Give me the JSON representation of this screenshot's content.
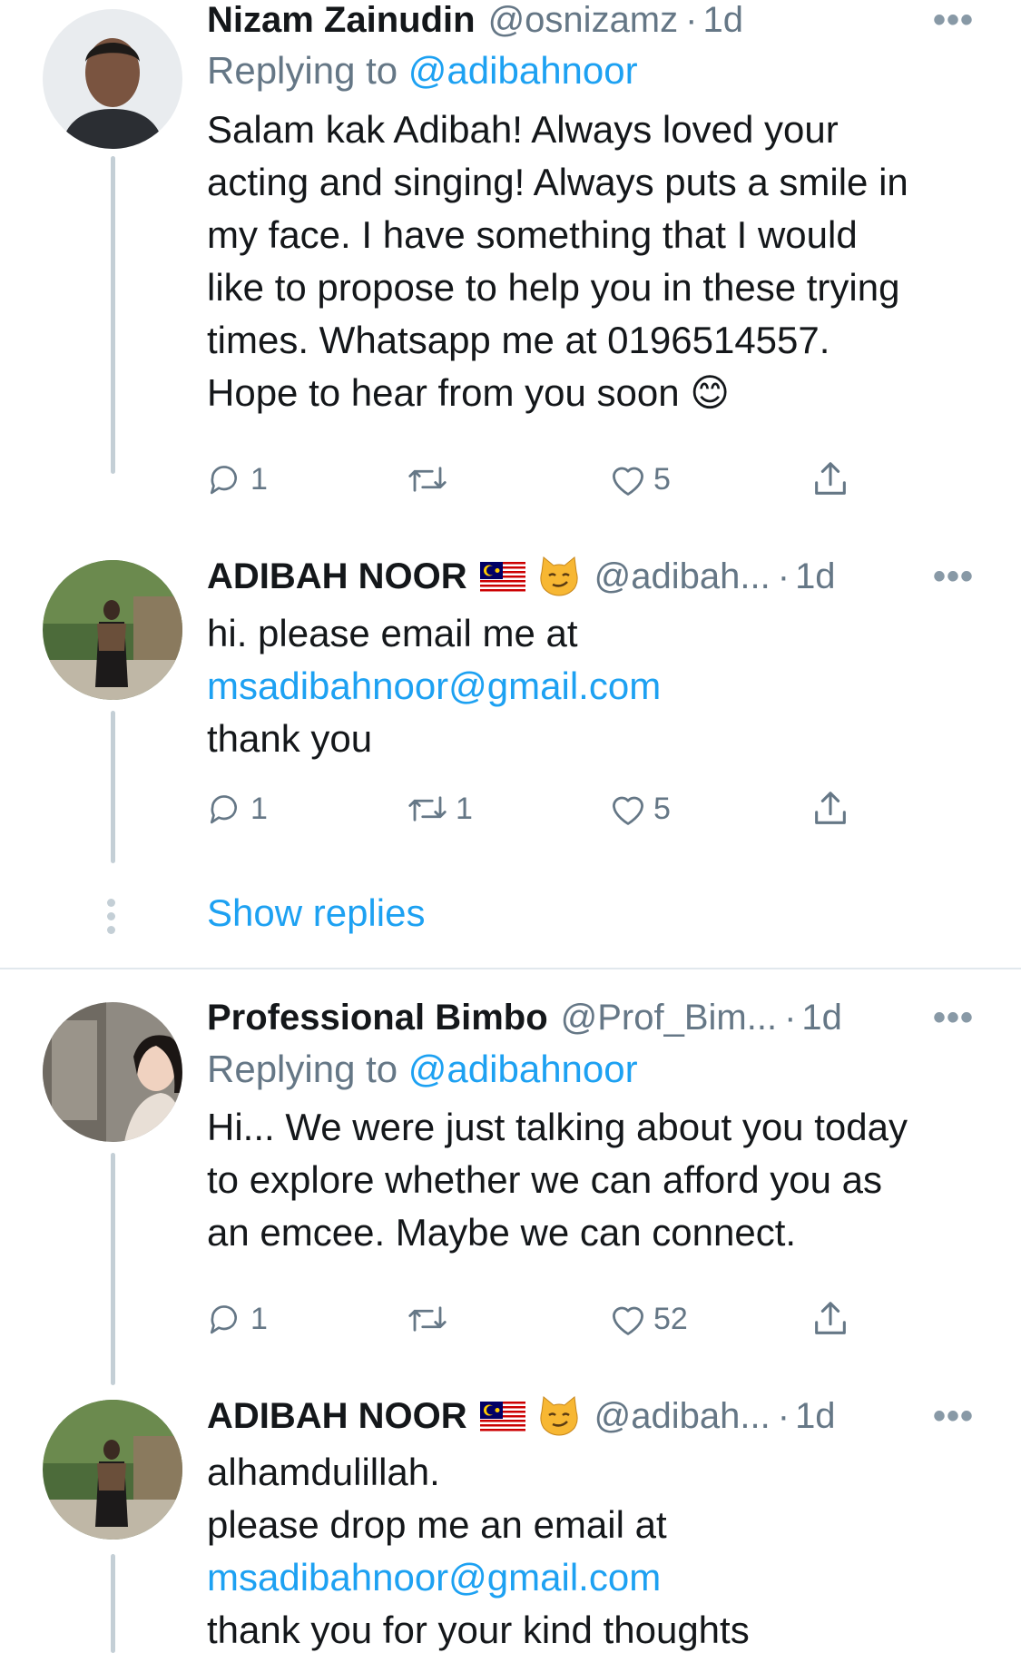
{
  "tweets": [
    {
      "name": "Nizam Zainudin",
      "handle": "@osnizamz",
      "sep": "·",
      "time": "1d",
      "more": "•••",
      "replying_prefix": "Replying to",
      "replying_to": "@adibahnoor",
      "lines": [
        "Salam kak Adibah! Always loved your",
        "acting and singing! Always puts a smile in",
        "my face. I have something that I would",
        "like to propose to help you in these trying",
        "times. Whatsapp me at 0196514557.",
        "Hope to hear from you soon 😊"
      ],
      "reply_count": "1",
      "retweet_count": "",
      "like_count": "5"
    },
    {
      "name": "ADIBAH NOOR",
      "handle": "@adibah...",
      "sep": "·",
      "time": "1d",
      "more": "•••",
      "lines": [
        "hi. please email me at"
      ],
      "link": "msadibahnoor@gmail.com",
      "after_link": [
        "thank you"
      ],
      "reply_count": "1",
      "retweet_count": "1",
      "like_count": "5"
    },
    {
      "name": "Professional Bimbo",
      "handle": "@Prof_Bim...",
      "sep": "·",
      "time": "1d",
      "more": "•••",
      "replying_prefix": "Replying to",
      "replying_to": "@adibahnoor",
      "lines": [
        "Hi... We were just talking about you today",
        "to explore whether we can afford you as",
        "an emcee. Maybe we can connect."
      ],
      "reply_count": "1",
      "retweet_count": "",
      "like_count": "52"
    },
    {
      "name": "ADIBAH NOOR",
      "handle": "@adibah...",
      "sep": "·",
      "time": "1d",
      "more": "•••",
      "lines": [
        "alhamdulillah.",
        "please drop me an email at"
      ],
      "link": "msadibahnoor@gmail.com",
      "after_link": [
        "thank you for your kind thoughts"
      ]
    }
  ],
  "show_replies": "Show replies",
  "colors": {
    "accent": "#1da1f2",
    "secondary": "#657786",
    "thread_line": "#c4cfd6",
    "divider": "#e1e8ed"
  },
  "icons": [
    "reply-icon",
    "retweet-icon",
    "like-icon",
    "share-icon",
    "more-icon",
    "flag-malaysia-icon",
    "smirking-cat-icon",
    "smiling-face-icon"
  ]
}
